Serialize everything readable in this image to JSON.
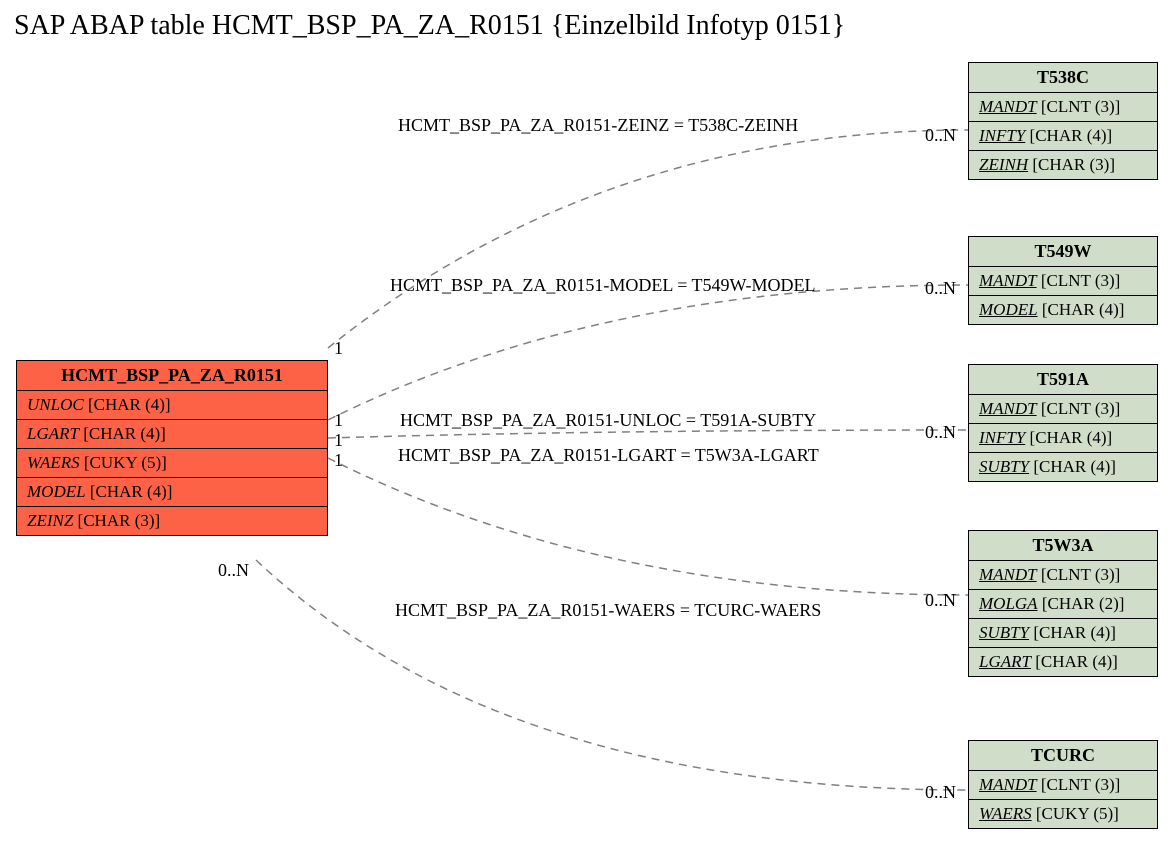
{
  "title": "SAP ABAP table HCMT_BSP_PA_ZA_R0151 {Einzelbild Infotyp 0151}",
  "main": {
    "name": "HCMT_BSP_PA_ZA_R0151",
    "fields": [
      {
        "n": "UNLOC",
        "t": "[CHAR (4)]",
        "u": false
      },
      {
        "n": "LGART",
        "t": "[CHAR (4)]",
        "u": false
      },
      {
        "n": "WAERS",
        "t": "[CUKY (5)]",
        "u": false
      },
      {
        "n": "MODEL",
        "t": "[CHAR (4)]",
        "u": false
      },
      {
        "n": "ZEINZ",
        "t": "[CHAR (3)]",
        "u": false
      }
    ]
  },
  "refs": [
    {
      "name": "T538C",
      "fields": [
        {
          "n": "MANDT",
          "t": "[CLNT (3)]",
          "u": true
        },
        {
          "n": "INFTY",
          "t": "[CHAR (4)]",
          "u": true
        },
        {
          "n": "ZEINH",
          "t": "[CHAR (3)]",
          "u": true
        }
      ]
    },
    {
      "name": "T549W",
      "fields": [
        {
          "n": "MANDT",
          "t": "[CLNT (3)]",
          "u": true
        },
        {
          "n": "MODEL",
          "t": "[CHAR (4)]",
          "u": true
        }
      ]
    },
    {
      "name": "T591A",
      "fields": [
        {
          "n": "MANDT",
          "t": "[CLNT (3)]",
          "u": true
        },
        {
          "n": "INFTY",
          "t": "[CHAR (4)]",
          "u": true
        },
        {
          "n": "SUBTY",
          "t": "[CHAR (4)]",
          "u": true
        }
      ]
    },
    {
      "name": "T5W3A",
      "fields": [
        {
          "n": "MANDT",
          "t": "[CLNT (3)]",
          "u": true
        },
        {
          "n": "MOLGA",
          "t": "[CHAR (2)]",
          "u": true
        },
        {
          "n": "SUBTY",
          "t": "[CHAR (4)]",
          "u": true
        },
        {
          "n": "LGART",
          "t": "[CHAR (4)]",
          "u": true
        }
      ]
    },
    {
      "name": "TCURC",
      "fields": [
        {
          "n": "MANDT",
          "t": "[CLNT (3)]",
          "u": true
        },
        {
          "n": "WAERS",
          "t": "[CUKY (5)]",
          "u": true
        }
      ]
    }
  ],
  "links": [
    {
      "label": "HCMT_BSP_PA_ZA_R0151-ZEINZ = T538C-ZEINH"
    },
    {
      "label": "HCMT_BSP_PA_ZA_R0151-MODEL = T549W-MODEL"
    },
    {
      "label": "HCMT_BSP_PA_ZA_R0151-UNLOC = T591A-SUBTY"
    },
    {
      "label": "HCMT_BSP_PA_ZA_R0151-LGART = T5W3A-LGART"
    },
    {
      "label": "HCMT_BSP_PA_ZA_R0151-WAERS = TCURC-WAERS"
    }
  ],
  "card": {
    "left": "1",
    "leftN": "0..N",
    "right": "0..N"
  }
}
